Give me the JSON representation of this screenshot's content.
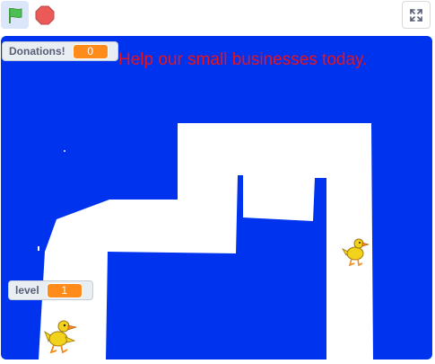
{
  "toolbar": {
    "green_flag_icon": "green-flag-icon",
    "stop_icon": "stop-sign-icon",
    "fullscreen_icon": "fullscreen-icon"
  },
  "stage": {
    "background_color": "#0033ee",
    "path_color": "#ffffff",
    "message": "Help our small businesses today."
  },
  "monitors": {
    "donations": {
      "label": "Donations!",
      "value": "0"
    },
    "level": {
      "label": "level",
      "value": "1"
    }
  },
  "sprites": {
    "duck_icon": "duck-sprite-icon"
  }
}
